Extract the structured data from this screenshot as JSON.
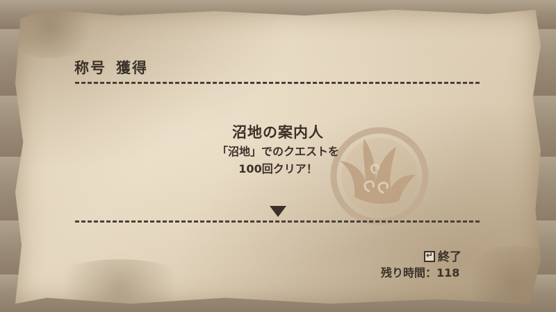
{
  "header": {
    "title_left": "称号",
    "title_right": "獲得"
  },
  "award": {
    "name": "沼地の案内人",
    "description_line1": "「沼地」でのクエストを",
    "description_line2": "100回クリア！",
    "emblem": "claw-emblem-icon"
  },
  "footer": {
    "end_key_icon": "enter-key-icon",
    "end_label": "終了",
    "time_label": "残り時間：",
    "time_value": "118"
  },
  "colors": {
    "ink": "#3b3129",
    "parchment": "#ded0b8",
    "wood": "#9a8b77",
    "emblem": "#b99f83"
  }
}
